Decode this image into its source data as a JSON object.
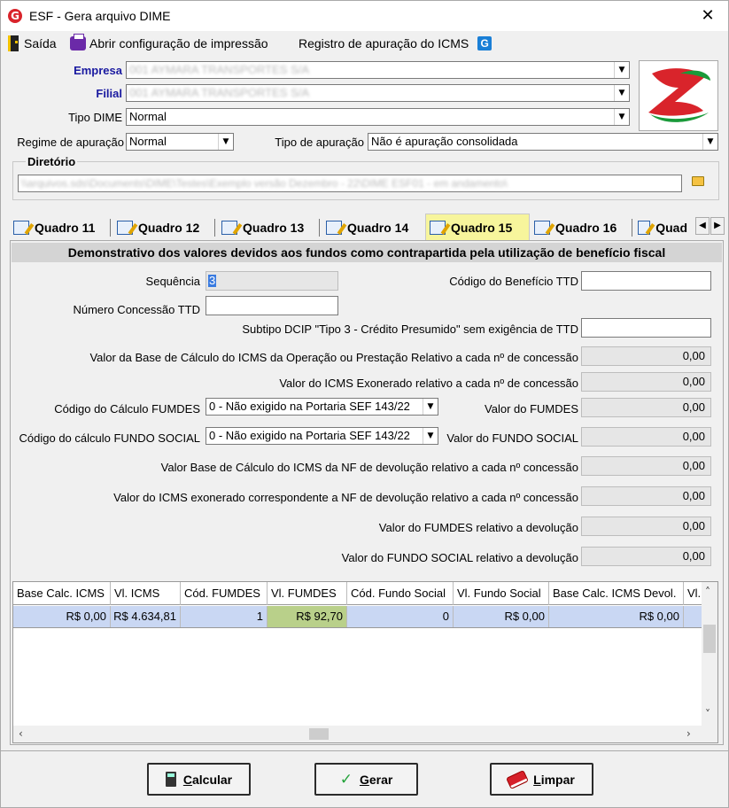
{
  "window": {
    "title": "ESF - Gera arquivo DIME"
  },
  "menu": {
    "exit_label": "Saída",
    "print_config_label": "Abrir configuração de impressão",
    "icms_register_label": "Registro de apuração do ICMS"
  },
  "form": {
    "empresa_label": "Empresa",
    "empresa_value": "001 AYMARA TRANSPORTES S/A",
    "filial_label": "Filial",
    "filial_value": "001 AYMARA TRANSPORTES S/A",
    "tipo_dime_label": "Tipo DIME",
    "tipo_dime_value": "Normal",
    "regime_label": "Regime de apuração",
    "regime_value": "Normal",
    "tipo_apuracao_label": "Tipo de apuração",
    "tipo_apuracao_value": "Não é apuração consolidada",
    "diretorio_label": "Diretório",
    "diretorio_value": "\\\\arquivos.sds\\Documents\\DIME\\Testes\\Exemplo versão Dezembro - 22\\DIME ESF01 - em andamento\\"
  },
  "tabs": [
    "Quadro 11",
    "Quadro 12",
    "Quadro 13",
    "Quadro 14",
    "Quadro 15",
    "Quadro 16",
    "Quad"
  ],
  "active_tab": "Quadro 15",
  "quadro15": {
    "header": "Demonstrativo dos valores devidos aos fundos como contrapartida pela utilização de benefício fiscal",
    "sequencia_label": "Sequência",
    "sequencia_value": "3",
    "codigo_beneficio_label": "Código do Benefício TTD",
    "numero_concessao_label": "Número Concessão TTD",
    "subtipo_label": "Subtipo DCIP \"Tipo 3 - Crédito Presumido\" sem exigência de TTD",
    "base_calculo_label": "Valor da Base de Cálculo do ICMS da Operação ou Prestação Relativo a cada nº de concessão",
    "base_calculo_value": "0,00",
    "icms_exonerado_label": "Valor do ICMS Exonerado relativo a cada nº de concessão",
    "icms_exonerado_value": "0,00",
    "codigo_fumdes_label": "Código do Cálculo FUMDES",
    "codigo_fumdes_value": "0 - Não exigido na Portaria SEF 143/22",
    "valor_fumdes_label": "Valor do FUMDES",
    "valor_fumdes_value": "0,00",
    "codigo_fundo_social_label": "Código do cálculo FUNDO SOCIAL",
    "codigo_fundo_social_value": "0 - Não exigido na Portaria SEF 143/22",
    "valor_fundo_social_label": "Valor do FUNDO SOCIAL",
    "valor_fundo_social_value": "0,00",
    "base_devolucao_label": "Valor Base de Cálculo do ICMS da NF de devolução relativo a cada nº concessão",
    "base_devolucao_value": "0,00",
    "icms_devolucao_label": "Valor do ICMS exonerado correspondente a NF de devolução relativo a cada nº concessão",
    "icms_devolucao_value": "0,00",
    "fumdes_devolucao_label": "Valor do FUMDES relativo a devolução",
    "fumdes_devolucao_value": "0,00",
    "fundo_social_devolucao_label": "Valor do FUNDO SOCIAL relativo a devolução",
    "fundo_social_devolucao_value": "0,00"
  },
  "grid": {
    "columns": [
      "Base Calc. ICMS",
      "Vl. ICMS",
      "Cód. FUMDES",
      "Vl. FUMDES",
      "Cód. Fundo Social",
      "Vl. Fundo Social",
      "Base Calc. ICMS Devol.",
      "Vl."
    ],
    "rows": [
      [
        "R$ 0,00",
        "R$ 4.634,81",
        "1",
        "R$ 92,70",
        "0",
        "R$ 0,00",
        "R$ 0,00",
        ""
      ]
    ]
  },
  "buttons": {
    "calcular_first": "C",
    "calcular_rest": "alcular",
    "gerar_first": "G",
    "gerar_rest": "erar",
    "limpar_first": "L",
    "limpar_rest": "impar"
  },
  "colors": {
    "active_tab": "#f7f59c",
    "row_selected": "#c9d7f3",
    "cell_highlight": "#b9d08a",
    "label_blue": "#1a1aa0"
  }
}
